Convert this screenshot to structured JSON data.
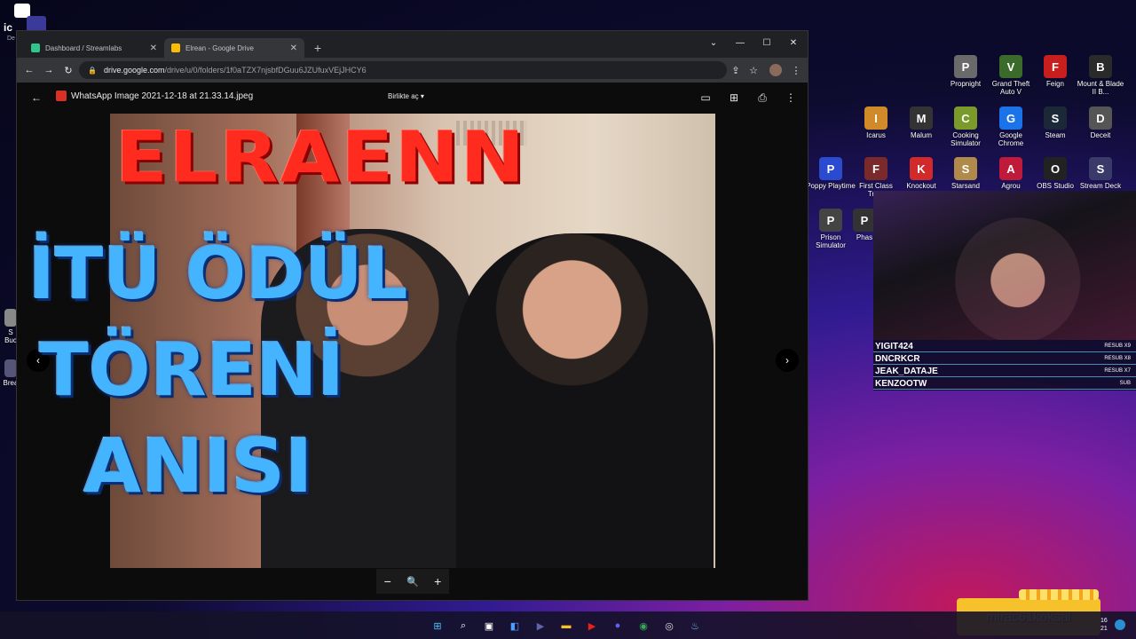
{
  "corner_app": {
    "label": "ic",
    "sub": "De"
  },
  "desktop_icons": [
    {
      "label": "Propnight",
      "color": "#6a6a6a",
      "glyph": "P"
    },
    {
      "label": "Grand Theft Auto V",
      "color": "#3a6b2a",
      "glyph": "V"
    },
    {
      "label": "Feign",
      "color": "#c81e1e",
      "glyph": "F"
    },
    {
      "label": "Mount & Blade II B...",
      "color": "#2a2a2a",
      "glyph": "B"
    },
    {
      "label": "Icarus",
      "color": "#d08a2a",
      "glyph": "I"
    },
    {
      "label": "Malum",
      "color": "#333",
      "glyph": "M"
    },
    {
      "label": "Cooking Simulator",
      "color": "#7a9a2a",
      "glyph": "C"
    },
    {
      "label": "Google Chrome",
      "color": "#1a73e8",
      "glyph": "G"
    },
    {
      "label": "Steam",
      "color": "#1b2838",
      "glyph": "S"
    },
    {
      "label": "Deceit",
      "color": "#555",
      "glyph": "D"
    },
    {
      "label": "Poppy Playtime",
      "color": "#2a4ad0",
      "glyph": "P"
    },
    {
      "label": "First Class Tro...",
      "color": "#7a2a2a",
      "glyph": "F"
    },
    {
      "label": "Knockout",
      "color": "#d02a2a",
      "glyph": "K"
    },
    {
      "label": "Starsand",
      "color": "#b08a4a",
      "glyph": "S"
    },
    {
      "label": "Agrou",
      "color": "#c01a3a",
      "glyph": "A"
    },
    {
      "label": "OBS Studio",
      "color": "#222",
      "glyph": "O"
    },
    {
      "label": "Stream Deck",
      "color": "#3a3a6a",
      "glyph": "S"
    },
    {
      "label": "Prison Simulator",
      "color": "#444",
      "glyph": "P"
    },
    {
      "label": "Phas",
      "color": "#333",
      "glyph": "P"
    }
  ],
  "left_edge_icons": [
    {
      "label": "S Buc",
      "color": "#888"
    },
    {
      "label": "Brea",
      "color": "#557"
    }
  ],
  "browser": {
    "tabs": [
      {
        "label": "Dashboard / Streamlabs",
        "color": "#31c48d"
      },
      {
        "label": "Elrean - Google Drive",
        "color": "#fbbc04"
      }
    ],
    "new_tab": "+",
    "url_main": "drive.google.com",
    "url_rest": "/drive/u/0/folders/1f0aTZX7njsbfDGuu6JZUfuxVEjJHCY6",
    "controls": {
      "minimize": "—",
      "maximize": "☐",
      "close": "✕",
      "dropdown": "⌄"
    }
  },
  "viewer": {
    "file_name": "WhatsApp Image 2021-12-18 at 21.33.14.jpeg",
    "open_with": "Birlikte aç",
    "zoom_out": "−",
    "zoom_icon": "🔍",
    "zoom_in": "+"
  },
  "thumbnail_text": {
    "line1": "ELRAENN",
    "line2": "İTÜ ÖDÜL",
    "line3": "TÖRENİ",
    "line4": "ANISI"
  },
  "subs": [
    {
      "name": "YIGIT424",
      "tier": "RESUB X9"
    },
    {
      "name": "DNCRKCR",
      "tier": "RESUB X8"
    },
    {
      "name": "JEAK_DATAJE",
      "tier": "RESUB X7"
    },
    {
      "name": "KENZOOTW",
      "tier": "SUB"
    }
  ],
  "donation": {
    "name": "mirac61koksal"
  },
  "taskbar": {
    "icons": [
      {
        "name": "windows-start",
        "glyph": "⊞",
        "color": "#4cc2ff"
      },
      {
        "name": "search",
        "glyph": "⌕",
        "color": "#fff"
      },
      {
        "name": "task-view",
        "glyph": "▣",
        "color": "#fff"
      },
      {
        "name": "widgets",
        "glyph": "◧",
        "color": "#4ca0ff"
      },
      {
        "name": "teams",
        "glyph": "▶",
        "color": "#6264a7"
      },
      {
        "name": "file-explorer",
        "glyph": "▬",
        "color": "#f6c12a"
      },
      {
        "name": "youtube-studio",
        "glyph": "▶",
        "color": "#e62117"
      },
      {
        "name": "discord",
        "glyph": "●",
        "color": "#5865f2"
      },
      {
        "name": "chrome",
        "glyph": "◉",
        "color": "#34a853"
      },
      {
        "name": "obs",
        "glyph": "◎",
        "color": "#ddd"
      },
      {
        "name": "steam",
        "glyph": "♨",
        "color": "#66c0f4"
      }
    ],
    "time": "16",
    "date": "21"
  }
}
